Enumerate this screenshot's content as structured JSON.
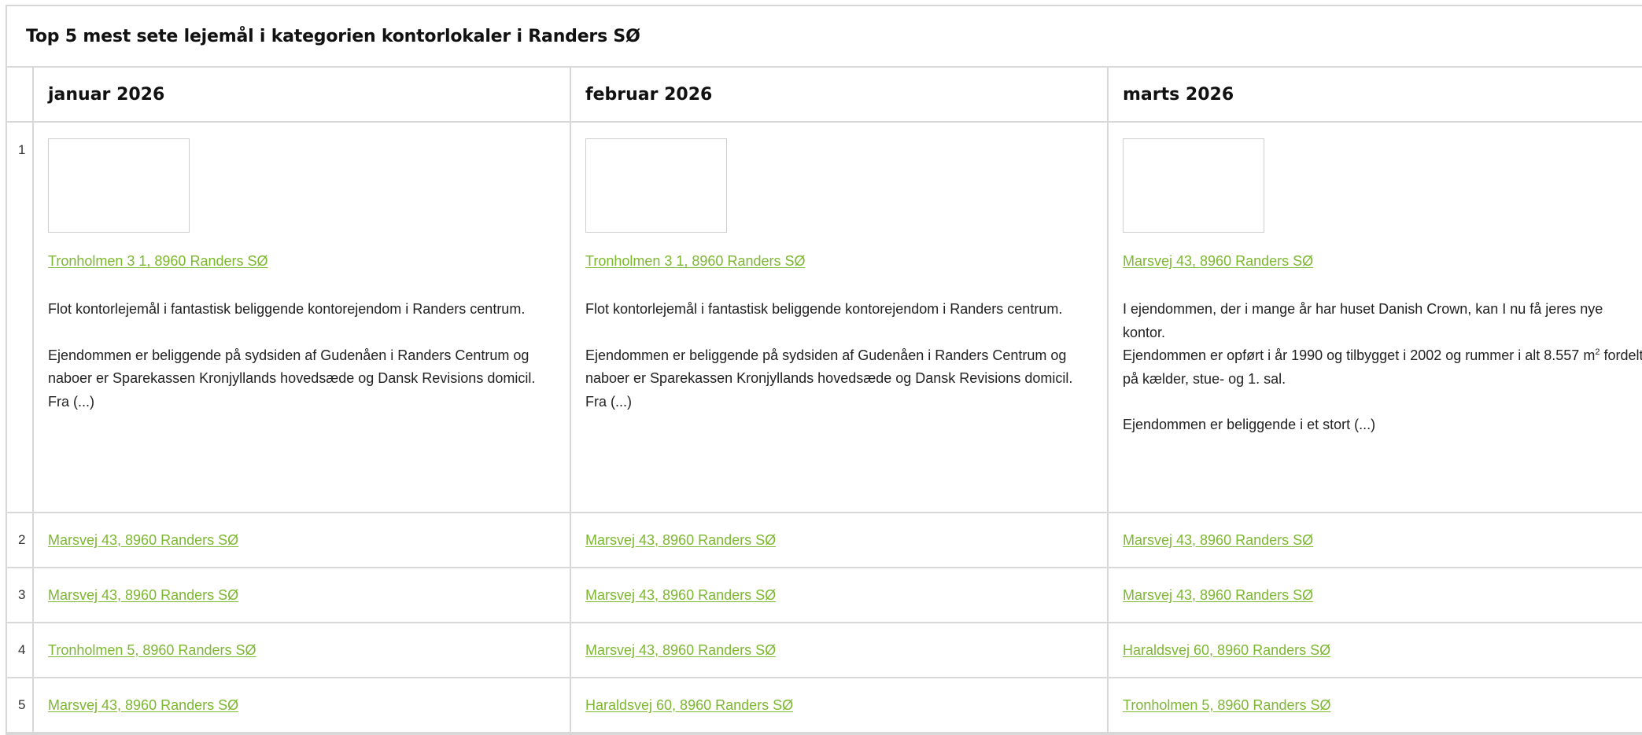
{
  "title": "Top 5 mest sete lejemål i kategorien kontorlokaler i Randers SØ",
  "colors": {
    "link": "#7cb82f",
    "border": "#d8d8d8"
  },
  "columns": [
    "januar 2026",
    "februar 2026",
    "marts 2026"
  ],
  "rows": [
    {
      "rank": "1",
      "cells": [
        {
          "address": "Tronholmen 3 1, 8960 Randers SØ",
          "desc_p1": "Flot kontorlejemål i fantastisk beliggende kontorejendom i Randers centrum.",
          "desc_p2": "Ejendommen er beliggende på sydsiden af Gudenåen i Randers Centrum og naboer er Sparekassen Kronjyllands hovedsæde og Dansk Revisions domicil.",
          "desc_p2_tail": "Fra (...)"
        },
        {
          "address": "Tronholmen 3 1, 8960 Randers SØ",
          "desc_p1": "Flot kontorlejemål i fantastisk beliggende kontorejendom i Randers centrum.",
          "desc_p2": "Ejendommen er beliggende på sydsiden af Gudenåen i Randers Centrum og naboer er Sparekassen Kronjyllands hovedsæde og Dansk Revisions domicil.",
          "desc_p2_tail": "Fra (...)"
        },
        {
          "address": "Marsvej 43, 8960 Randers SØ",
          "desc_p1": "I ejendommen, der i mange år har huset Danish Crown, kan I nu få jeres nye kontor.",
          "desc_p1b_pre": "Ejendommen er opført i år 1990 og tilbygget i 2002 og rummer i alt 8.557 m",
          "desc_p1b_sup": "2",
          "desc_p1b_post": " fordelt på kælder, stue- og 1. sal.",
          "desc_p2": "Ejendommen er beliggende i et stort (...)"
        }
      ]
    },
    {
      "rank": "2",
      "cells": [
        "Marsvej 43, 8960 Randers SØ",
        "Marsvej 43, 8960 Randers SØ",
        "Marsvej 43, 8960 Randers SØ"
      ]
    },
    {
      "rank": "3",
      "cells": [
        "Marsvej 43, 8960 Randers SØ",
        "Marsvej 43, 8960 Randers SØ",
        "Marsvej 43, 8960 Randers SØ"
      ]
    },
    {
      "rank": "4",
      "cells": [
        "Tronholmen 5, 8960 Randers SØ",
        "Marsvej 43, 8960 Randers SØ",
        "Haraldsvej 60, 8960 Randers SØ"
      ]
    },
    {
      "rank": "5",
      "cells": [
        "Marsvej 43, 8960 Randers SØ",
        "Haraldsvej 60, 8960 Randers SØ",
        "Tronholmen 5, 8960 Randers SØ"
      ]
    }
  ]
}
